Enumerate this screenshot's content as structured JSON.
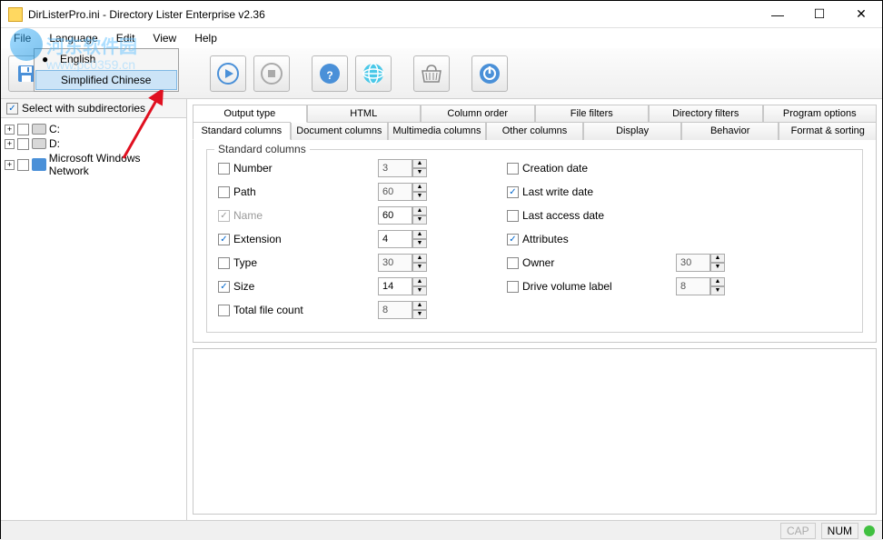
{
  "title": "DirListerPro.ini - Directory Lister Enterprise v2.36",
  "menu": {
    "file": "File",
    "language": "Language",
    "edit": "Edit",
    "view": "View",
    "help": "Help"
  },
  "watermark": {
    "text": "河东软件园",
    "url": "www.pc0359.cn"
  },
  "lang_popup": {
    "english": "English",
    "chinese": "Simplified Chinese"
  },
  "left": {
    "subdirs": "Select with subdirectories",
    "drive_c": "C:",
    "drive_d": "D:",
    "network": "Microsoft Windows Network"
  },
  "tabs1": {
    "output_type": "Output type",
    "html": "HTML",
    "column_order": "Column order",
    "file_filters": "File filters",
    "directory_filters": "Directory filters",
    "program_options": "Program options"
  },
  "tabs2": {
    "standard": "Standard columns",
    "document": "Document columns",
    "multimedia": "Multimedia columns",
    "other": "Other columns",
    "display": "Display",
    "behavior": "Behavior",
    "format": "Format & sorting"
  },
  "fieldset_label": "Standard columns",
  "cols": {
    "number": "Number",
    "number_v": "3",
    "path": "Path",
    "path_v": "60",
    "name": "Name",
    "name_v": "60",
    "extension": "Extension",
    "extension_v": "4",
    "type": "Type",
    "type_v": "30",
    "size": "Size",
    "size_v": "14",
    "total": "Total file count",
    "total_v": "8",
    "creation": "Creation date",
    "lastwrite": "Last write date",
    "lastaccess": "Last access date",
    "attributes": "Attributes",
    "owner": "Owner",
    "owner_v": "30",
    "volume": "Drive volume label",
    "volume_v": "8"
  },
  "status": {
    "cap": "CAP",
    "num": "NUM"
  }
}
